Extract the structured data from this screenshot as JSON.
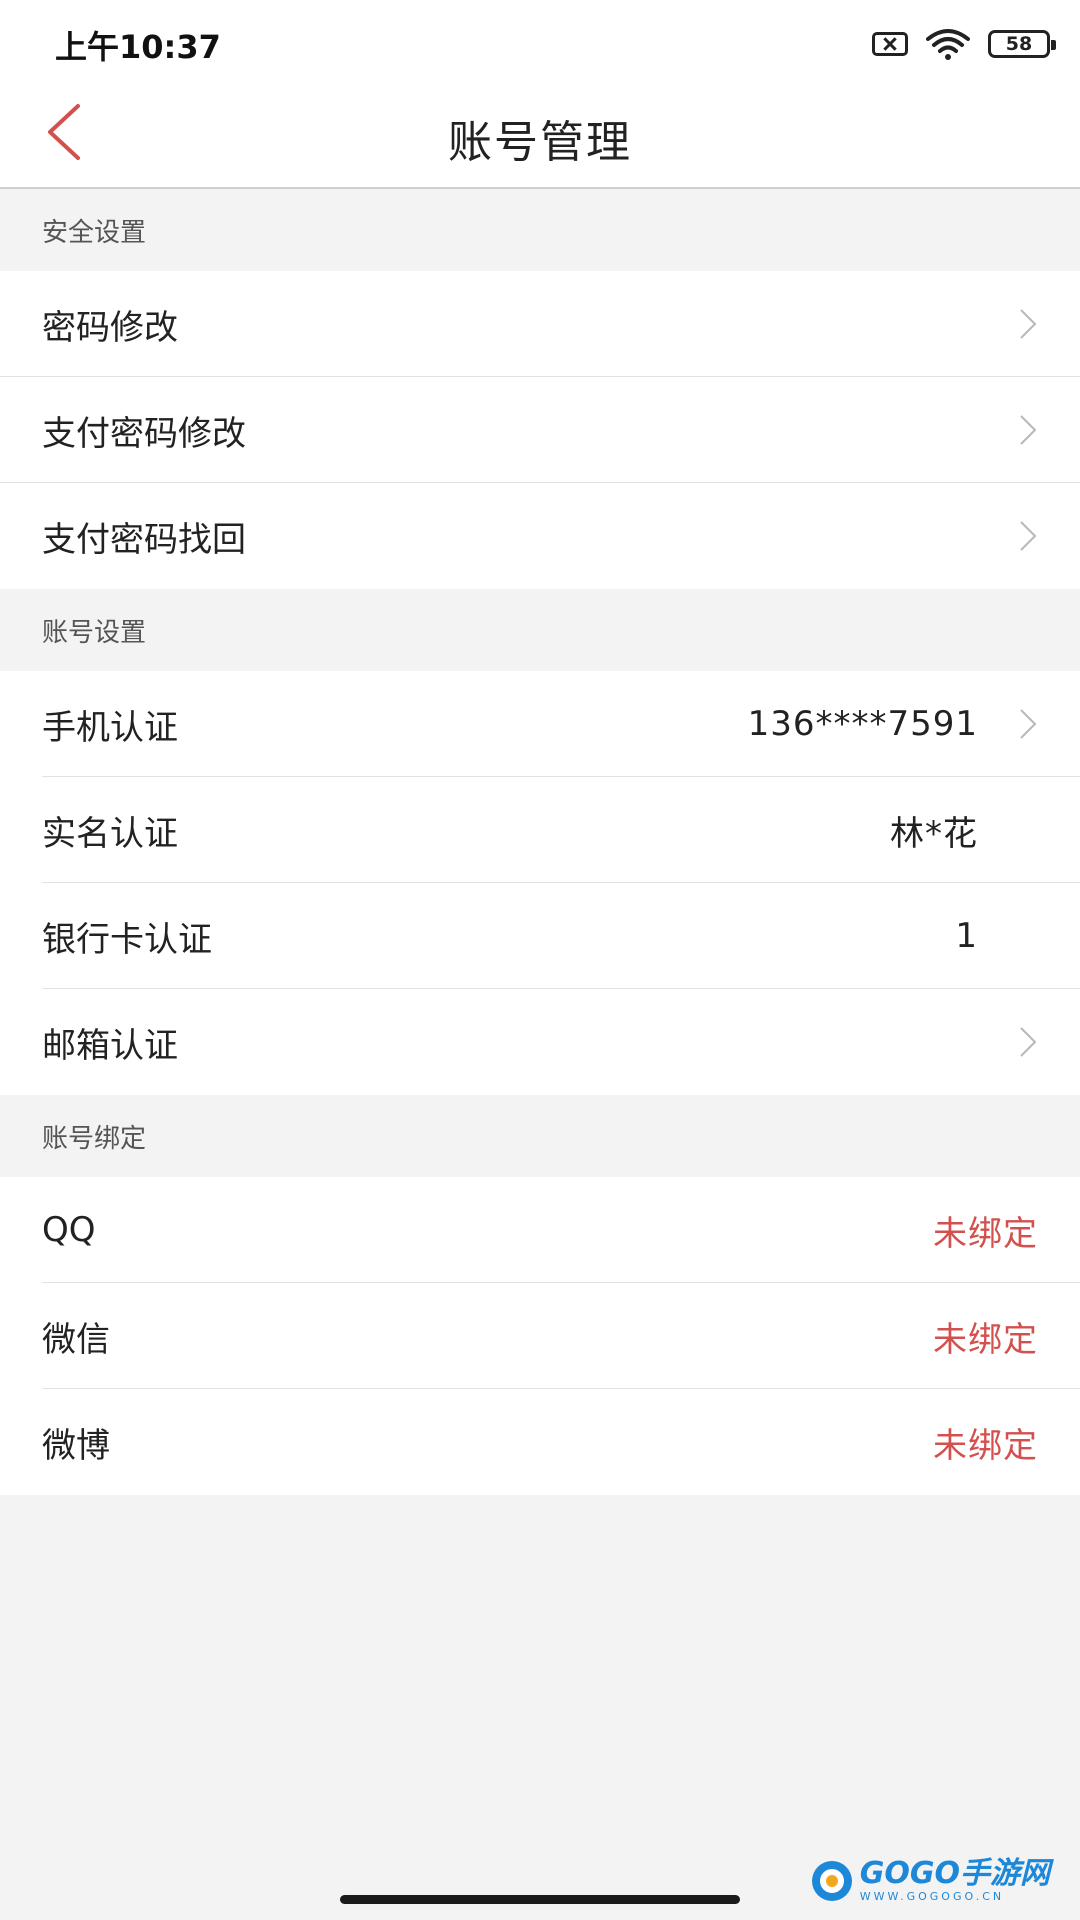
{
  "status_bar": {
    "time": "上午10:37",
    "battery": "58"
  },
  "nav": {
    "title": "账号管理"
  },
  "sections": [
    {
      "header": "安全设置",
      "rows": [
        {
          "label": "密码修改",
          "value": "",
          "chevron": true
        },
        {
          "label": "支付密码修改",
          "value": "",
          "chevron": true
        },
        {
          "label": "支付密码找回",
          "value": "",
          "chevron": true
        }
      ]
    },
    {
      "header": "账号设置",
      "rows": [
        {
          "label": "手机认证",
          "value": "136****7591",
          "chevron": true
        },
        {
          "label": "实名认证",
          "value": "林*花",
          "chevron": false
        },
        {
          "label": "银行卡认证",
          "value": "1",
          "chevron": false
        },
        {
          "label": "邮箱认证",
          "value": "",
          "chevron": true
        }
      ]
    },
    {
      "header": "账号绑定",
      "rows": [
        {
          "label": "QQ",
          "value": "未绑定",
          "chevron": false
        },
        {
          "label": "微信",
          "value": "未绑定",
          "chevron": false
        },
        {
          "label": "微博",
          "value": "未绑定",
          "chevron": false
        }
      ]
    }
  ],
  "colors": {
    "accent": "#d2504d",
    "background": "#f3f3f3"
  },
  "watermark": {
    "main": "GOGO手游网",
    "sub": "WWW.GOGOGO.CN"
  }
}
